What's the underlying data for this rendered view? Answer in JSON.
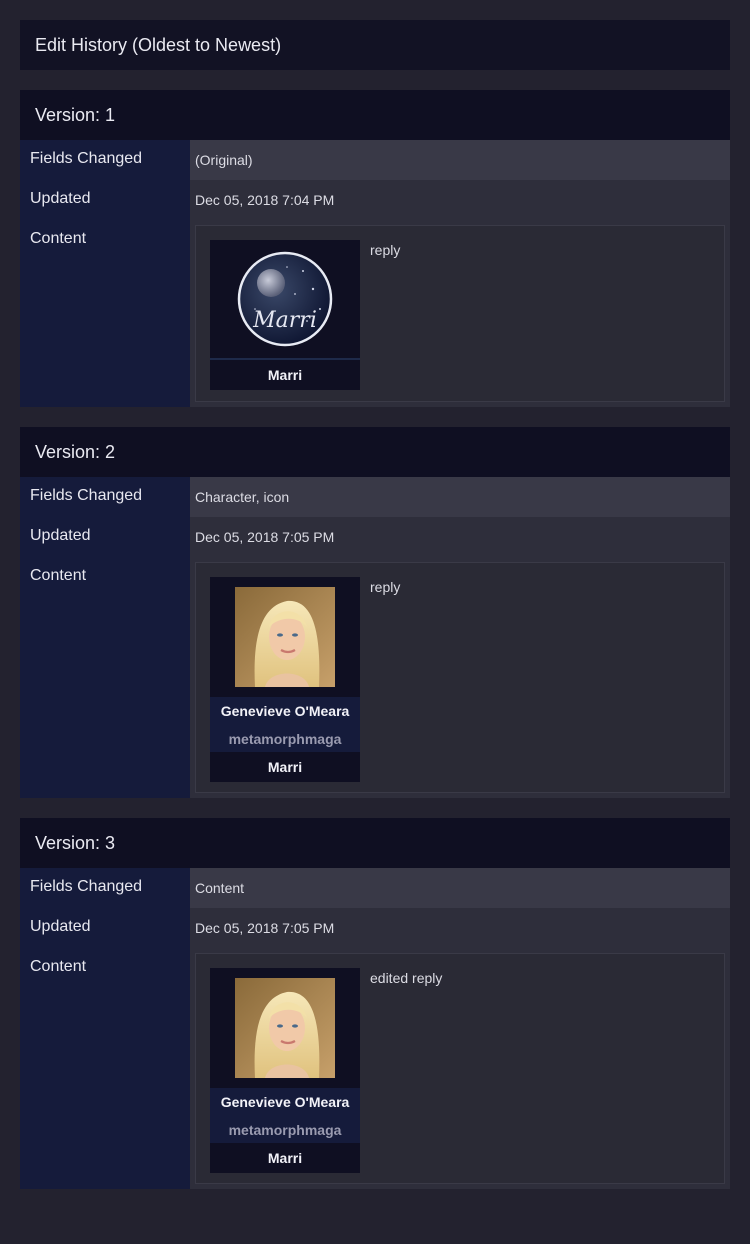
{
  "header": {
    "title": "Edit History (Oldest to Newest)"
  },
  "labels": {
    "fields_changed": "Fields Changed",
    "updated": "Updated",
    "content": "Content"
  },
  "versions": [
    {
      "title": "Version: 1",
      "fields_changed": "(Original)",
      "updated": "Dec 05, 2018 7:04 PM",
      "icon": "moon-avatar-icon",
      "icon_text": "Marri",
      "user": "Marri",
      "text": "reply"
    },
    {
      "title": "Version: 2",
      "fields_changed": "Character, icon",
      "updated": "Dec 05, 2018 7:05 PM",
      "icon": "portrait-avatar-icon",
      "character": "Genevieve O'Meara",
      "screenname": "metamorphmaga",
      "user": "Marri",
      "text": "reply"
    },
    {
      "title": "Version: 3",
      "fields_changed": "Content",
      "updated": "Dec 05, 2018 7:05 PM",
      "icon": "portrait-avatar-icon",
      "character": "Genevieve O'Meara",
      "screenname": "metamorphmaga",
      "user": "Marri",
      "text": "edited reply"
    }
  ],
  "colors": {
    "page_bg": "#23222f",
    "title_bar": "#0f0f22",
    "label_col": "#151b3b",
    "row_alt": "#393947",
    "row_bg": "#2e2e3b"
  }
}
